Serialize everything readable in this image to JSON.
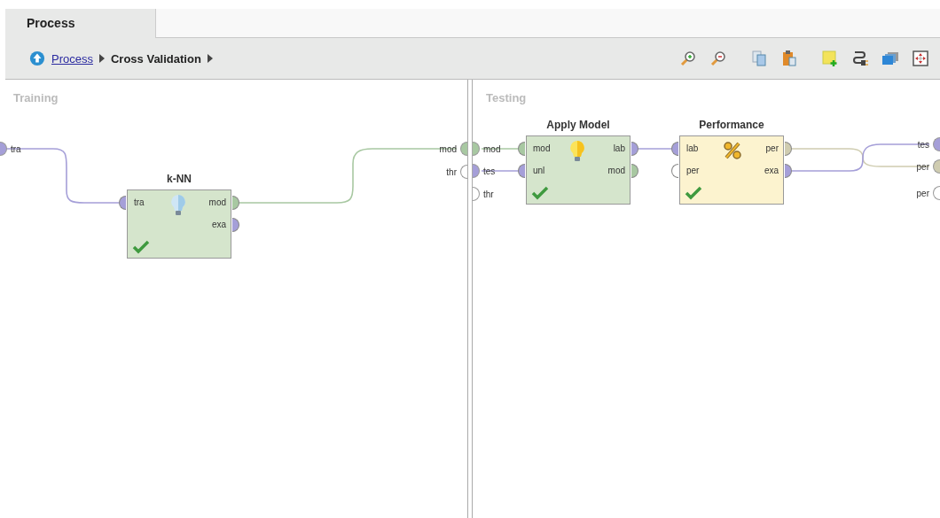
{
  "tab": {
    "label": "Process",
    "selected": true
  },
  "breadcrumb": [
    {
      "label": "Process",
      "kind": "link"
    },
    {
      "label": "Cross Validation",
      "kind": "current"
    }
  ],
  "panels": [
    {
      "title": "Training",
      "inputs": [
        {
          "label": "tra",
          "color": "#a59fd8"
        }
      ],
      "outputs": [
        {
          "label": "mod",
          "color": "#a8c8a2"
        },
        {
          "label": "thr",
          "color": "#ffffff"
        }
      ],
      "operators": [
        {
          "name": "k-NN",
          "kind": "learner",
          "ok": true,
          "inputs": [
            {
              "label": "tra",
              "color": "#a59fd8"
            }
          ],
          "outputs": [
            {
              "label": "mod",
              "color": "#a8c8a2"
            },
            {
              "label": "exa",
              "color": "#a59fd8"
            }
          ]
        }
      ]
    },
    {
      "title": "Testing",
      "inputs": [
        {
          "label": "mod",
          "color": "#a8c8a2"
        },
        {
          "label": "tes",
          "color": "#a59fd8"
        },
        {
          "label": "thr",
          "color": "#ffffff"
        }
      ],
      "outputs": [
        {
          "label": "tes",
          "color": "#a59fd8"
        },
        {
          "label": "per",
          "color": "#cfccb0"
        },
        {
          "label": "per",
          "color": "#ffffff"
        }
      ],
      "operators": [
        {
          "name": "Apply Model",
          "kind": "applier",
          "ok": true,
          "inputs": [
            {
              "label": "mod",
              "color": "#a8c8a2"
            },
            {
              "label": "unl",
              "color": "#a59fd8"
            }
          ],
          "outputs": [
            {
              "label": "lab",
              "color": "#a59fd8"
            },
            {
              "label": "mod",
              "color": "#a8c8a2"
            }
          ]
        },
        {
          "name": "Performance",
          "kind": "performance",
          "ok": true,
          "inputs": [
            {
              "label": "lab",
              "color": "#a59fd8"
            },
            {
              "label": "per",
              "color": "#ffffff"
            }
          ],
          "outputs": [
            {
              "label": "per",
              "color": "#cfccb0"
            },
            {
              "label": "exa",
              "color": "#a59fd8"
            }
          ]
        }
      ]
    }
  ]
}
